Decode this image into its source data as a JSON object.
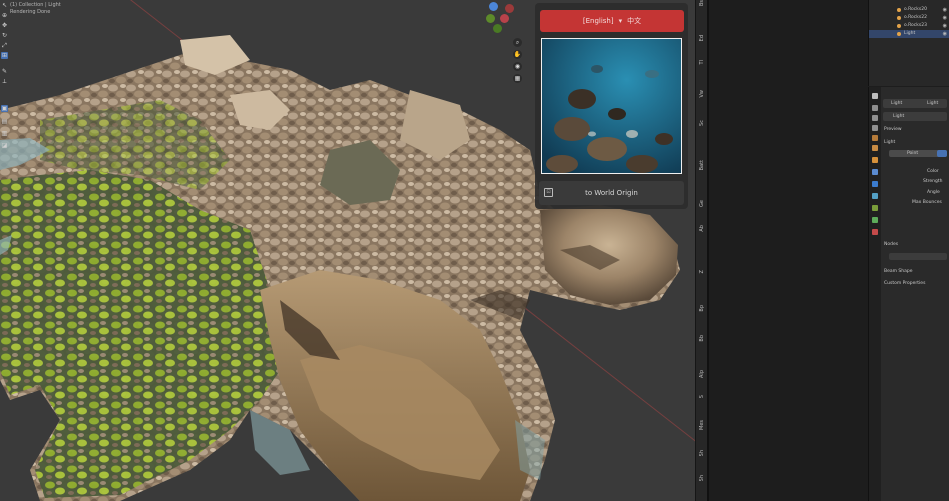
{
  "viewport": {
    "info_line1": "(1) Collection | Light",
    "info_line2": "Rendering Done"
  },
  "panel": {
    "language_button": "[English]",
    "language_alt": "中文",
    "world_origin_button": "to World Origin"
  },
  "sidebar_tabs": [
    "Bs",
    "Ed",
    "Tl",
    "Vw",
    "Sc",
    "Batt",
    "Ge",
    "Ab",
    "Z",
    "Bp",
    "Bb",
    "Alp",
    "S",
    "Mes",
    "Sh",
    "Sh"
  ],
  "outliner": {
    "rows": [
      "o.Rocks20",
      "o.Rocks22",
      "o.Rocks23",
      "Light"
    ],
    "selected": "Light"
  },
  "properties": {
    "header_left": "Light",
    "header_right": "Light",
    "object_name": "Light",
    "sections": [
      "Preview",
      "Light"
    ],
    "light_type": "Point",
    "fields": [
      "Color",
      "Strength",
      "Angle",
      "Max Bounces"
    ],
    "subsections": [
      "Nodes",
      "Custom Properties"
    ],
    "lower_sections": [
      "Beam Shape",
      "Custom Properties"
    ]
  },
  "colors": {
    "accent_red": "#c43534",
    "selection_blue": "#4772b3",
    "viewport_bg": "#3a3a3a"
  }
}
